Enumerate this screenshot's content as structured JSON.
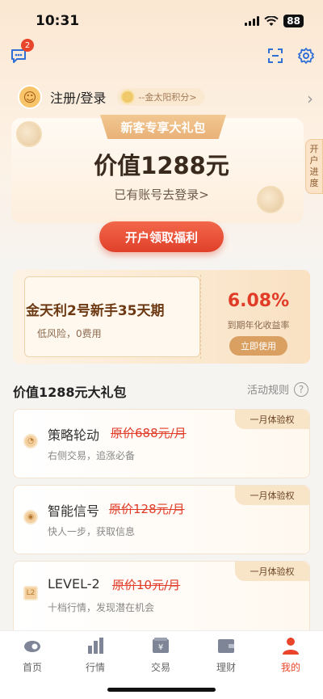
{
  "status": {
    "time": "10:31",
    "battery": "88"
  },
  "topbar": {
    "message_badge": "2"
  },
  "user": {
    "login_label": "注册/登录",
    "points_label": "--金太阳积分>"
  },
  "gift": {
    "ribbon": "新客专享大礼包",
    "value": "价值1288元",
    "login_link": "已有账号去登录>",
    "side_tab": "开户进度",
    "cta": "开户领取福利"
  },
  "coupon": {
    "title": "金天利2号新手35天期",
    "subtitle": "低风险，0费用",
    "rate": "6.08%",
    "rate_label": "到期年化收益率",
    "button": "立即使用"
  },
  "section": {
    "title": "价值1288元大礼包",
    "rules": "活动规则"
  },
  "benefits": [
    {
      "name": "策略轮动",
      "price": "原价688元/月",
      "desc": "右侧交易，追涨必备",
      "tag": "一月体验权",
      "icon": "strategy-icon"
    },
    {
      "name": "智能信号",
      "price": "原价128元/月",
      "desc": "快人一步，获取信息",
      "tag": "一月体验权",
      "icon": "signal-icon"
    },
    {
      "name": "LEVEL-2",
      "price": "原价10元/月",
      "desc": "十档行情，发现潜在机会",
      "tag": "一月体验权",
      "icon": "level2-icon"
    }
  ],
  "tabs": [
    {
      "label": "首页",
      "icon": "home-icon"
    },
    {
      "label": "行情",
      "icon": "chart-icon"
    },
    {
      "label": "交易",
      "icon": "trade-icon"
    },
    {
      "label": "理财",
      "icon": "wallet-icon"
    },
    {
      "label": "我的",
      "icon": "profile-icon"
    }
  ],
  "colors": {
    "accent": "#e8452b",
    "gold": "#d9a062"
  }
}
